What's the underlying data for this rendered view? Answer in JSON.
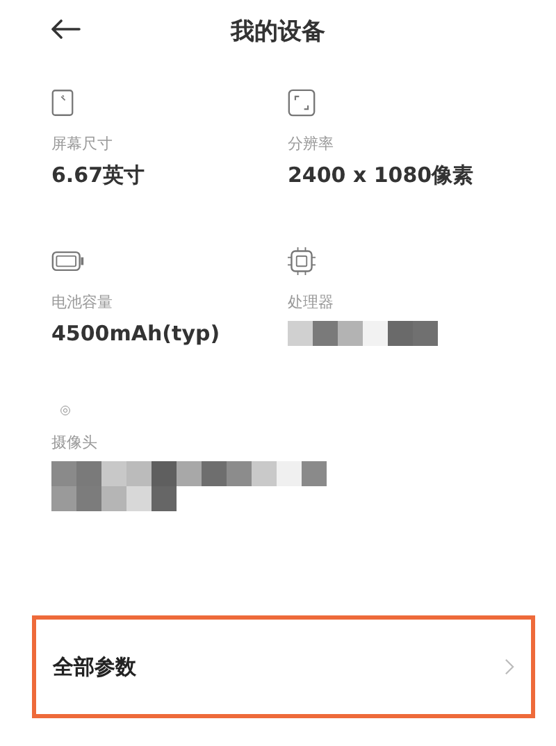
{
  "header": {
    "title": "我的设备"
  },
  "specs": [
    {
      "kind": "screen",
      "label": "屏幕尺寸",
      "value": "6.67英寸",
      "redacted": false
    },
    {
      "kind": "resolution",
      "label": "分辨率",
      "value": "2400 x 1080像素",
      "redacted": false
    },
    {
      "kind": "battery",
      "label": "电池容量",
      "value": "4500mAh(typ)",
      "redacted": false
    },
    {
      "kind": "chip",
      "label": "处理器",
      "redacted": true
    },
    {
      "kind": "camera",
      "label": "摄像头",
      "redacted": true
    }
  ],
  "all_params": {
    "label": "全部参数",
    "highlighted": true
  }
}
